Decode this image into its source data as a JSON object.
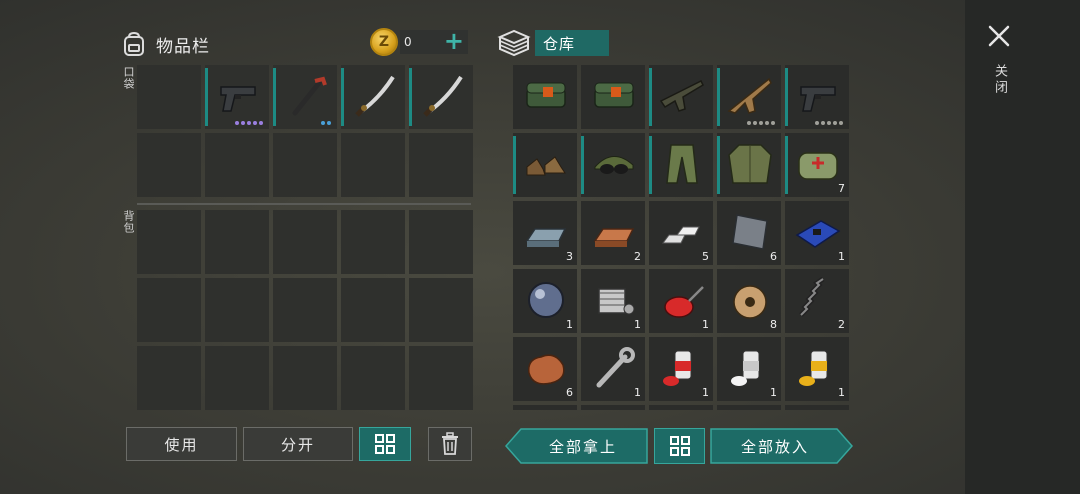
{
  "inventory": {
    "title": "物品栏",
    "pocket_label": "口袋",
    "backpack_label": "背包",
    "coins": "0",
    "coin_symbol": "Z",
    "plus_label": "+",
    "pocket": [
      {
        "item": "empty"
      },
      {
        "item": "pistol",
        "dots": [
          "#9a7fe0",
          "#9a7fe0",
          "#9a7fe0",
          "#9a7fe0",
          "#9a7fe0"
        ],
        "bar": true
      },
      {
        "item": "tire-iron",
        "dots": [
          "#4aa0d8",
          "#4aa0d8"
        ],
        "bar": true
      },
      {
        "item": "katana",
        "bar": true
      },
      {
        "item": "katana",
        "bar": true
      },
      {
        "item": "empty"
      },
      {
        "item": "empty"
      },
      {
        "item": "empty"
      },
      {
        "item": "empty"
      },
      {
        "item": "empty"
      }
    ],
    "backpack_slots": 15
  },
  "storage": {
    "title": "仓库",
    "items": [
      {
        "item": "explosive",
        "count": ""
      },
      {
        "item": "explosive",
        "count": ""
      },
      {
        "item": "assault-rifle",
        "count": "",
        "bar": true
      },
      {
        "item": "rifle",
        "count": "",
        "dots": [
          "#a0a09a",
          "#a0a09a",
          "#a0a09a",
          "#a0a09a",
          "#a0a09a"
        ],
        "bar": true
      },
      {
        "item": "pistol",
        "count": "",
        "dots": [
          "#a0a09a",
          "#a0a09a",
          "#a0a09a",
          "#a0a09a",
          "#a0a09a"
        ],
        "bar": true
      },
      {
        "item": "boots",
        "count": "",
        "bar": true
      },
      {
        "item": "cap-goggles",
        "count": "",
        "bar": true
      },
      {
        "item": "camo-pants",
        "count": "",
        "bar": true
      },
      {
        "item": "camo-jacket",
        "count": "",
        "bar": true
      },
      {
        "item": "medkit",
        "count": "7",
        "bar": true
      },
      {
        "item": "steel-ingot",
        "count": "3"
      },
      {
        "item": "copper-ingot",
        "count": "2"
      },
      {
        "item": "aluminum-bars",
        "count": "5"
      },
      {
        "item": "metal-plate",
        "count": "6"
      },
      {
        "item": "circuit-board",
        "count": "1"
      },
      {
        "item": "lens",
        "count": "1"
      },
      {
        "item": "engine",
        "count": "1"
      },
      {
        "item": "oil-can",
        "count": "1"
      },
      {
        "item": "wire-spool",
        "count": "8"
      },
      {
        "item": "spring",
        "count": "2"
      },
      {
        "item": "copper-ore",
        "count": "6"
      },
      {
        "item": "wrench",
        "count": "1"
      },
      {
        "item": "paint-red",
        "count": "1"
      },
      {
        "item": "paint-white",
        "count": "1"
      },
      {
        "item": "paint-yellow",
        "count": "1"
      },
      {
        "item": "partial",
        "count": ""
      },
      {
        "item": "empty",
        "count": ""
      },
      {
        "item": "empty",
        "count": ""
      },
      {
        "item": "empty",
        "count": ""
      },
      {
        "item": "empty",
        "count": ""
      }
    ]
  },
  "buttons": {
    "use": "使用",
    "split": "分开",
    "take_all": "全部拿上",
    "put_all": "全部放入"
  },
  "close_label": "关闭",
  "colors": {
    "accent": "#1d6b66",
    "accent_light": "#36a69c"
  }
}
